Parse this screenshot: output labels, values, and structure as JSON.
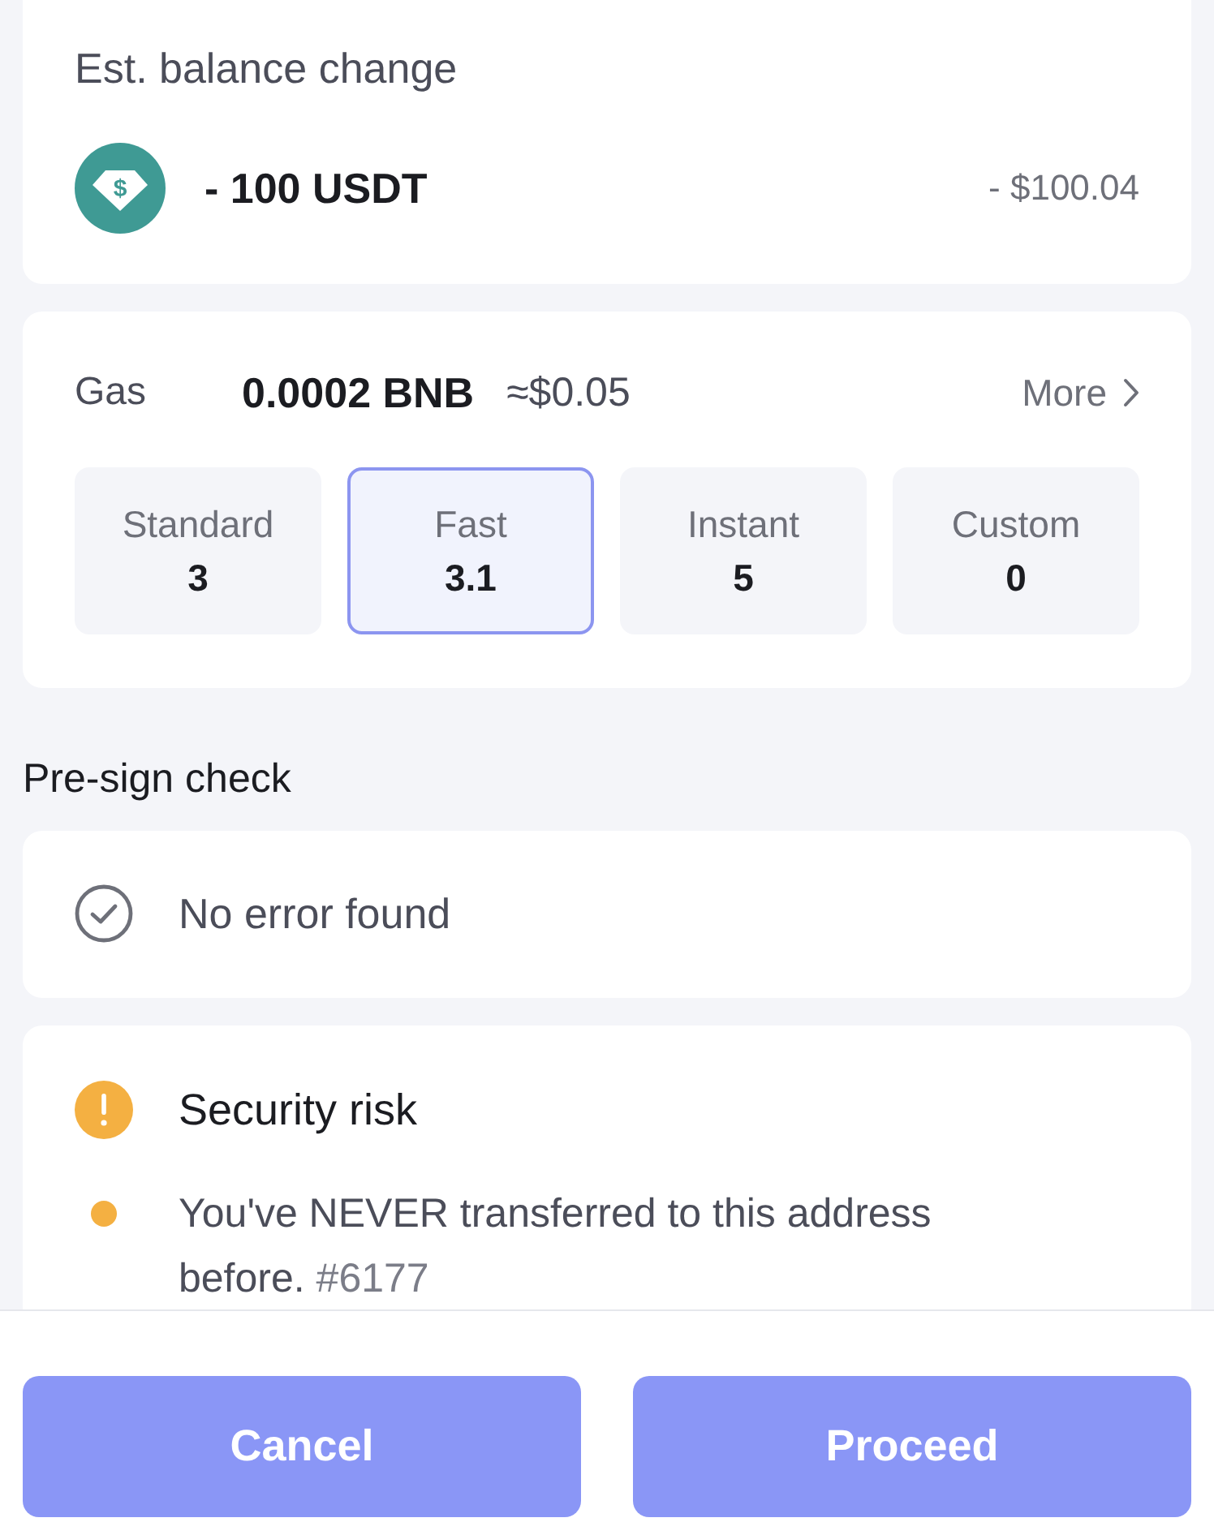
{
  "balance_change": {
    "title": "Est. balance change",
    "token_glyph": "$",
    "amount": "- 100 USDT",
    "fiat": "- $100.04"
  },
  "gas": {
    "label": "Gas",
    "amount": "0.0002 BNB",
    "fiat": "≈$0.05",
    "more": "More",
    "options": [
      {
        "label": "Standard",
        "value": "3",
        "selected": false
      },
      {
        "label": "Fast",
        "value": "3.1",
        "selected": true
      },
      {
        "label": "Instant",
        "value": "5",
        "selected": false
      },
      {
        "label": "Custom",
        "value": "0",
        "selected": false
      }
    ]
  },
  "pre_sign_check": {
    "title": "Pre-sign check",
    "results": [
      {
        "kind": "pass",
        "text": "No error found"
      },
      {
        "kind": "warning",
        "title": "Security risk",
        "items": [
          {
            "text": "You've NEVER transferred to this address before.",
            "ref": "#6177"
          }
        ]
      }
    ]
  },
  "buttons": [
    {
      "label": "Cancel"
    },
    {
      "label": "Proceed"
    }
  ]
}
